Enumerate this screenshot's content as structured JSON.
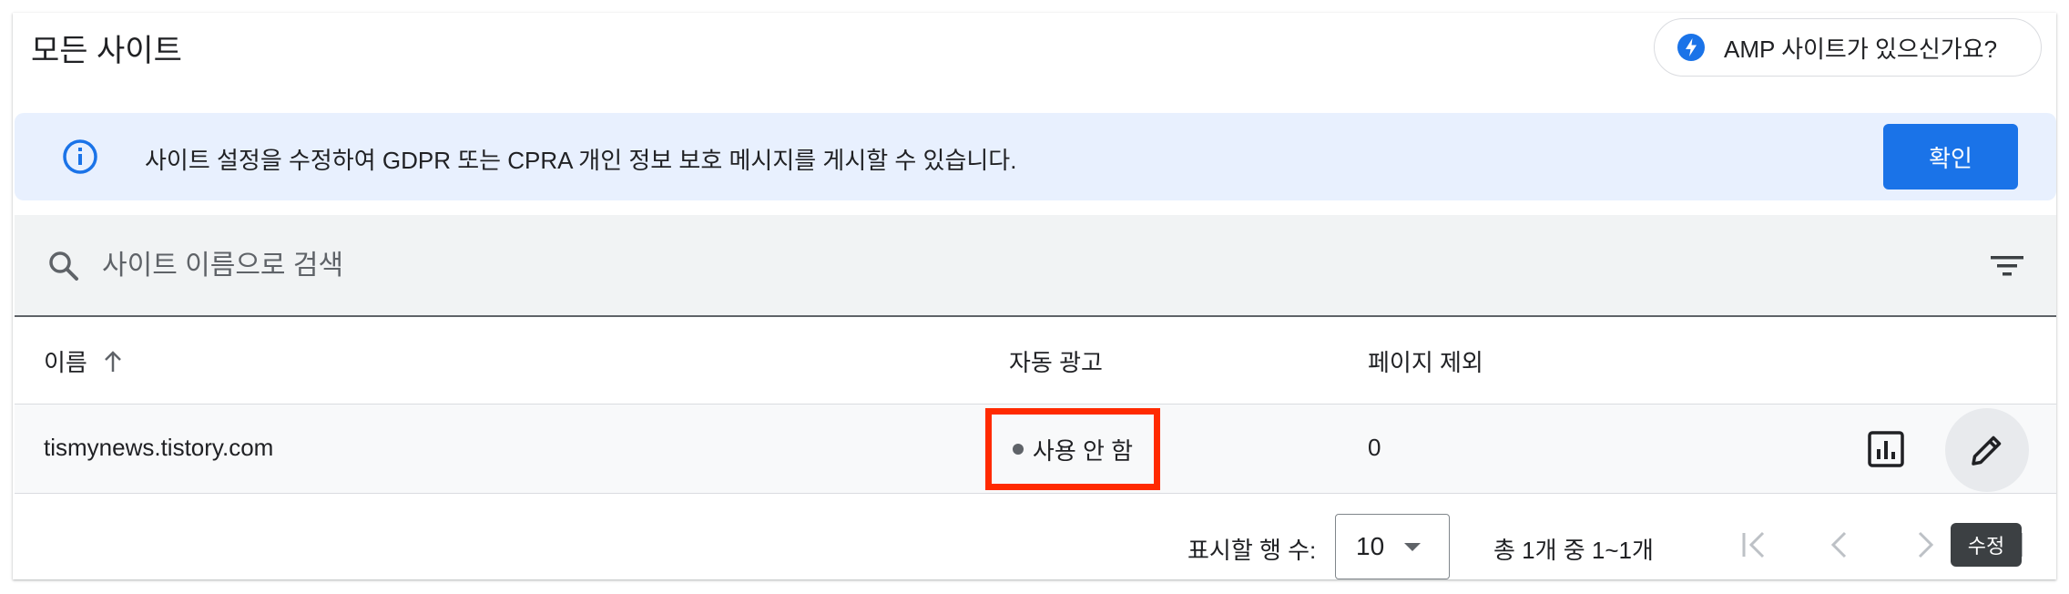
{
  "header": {
    "title": "모든 사이트",
    "amp_chip_label": "AMP 사이트가 있으신가요?",
    "amp_icon": "lightning-bolt-icon"
  },
  "banner": {
    "icon": "info-icon",
    "text": "사이트 설정을 수정하여 GDPR 또는 CPRA 개인 정보 보호 메시지를 게시할 수 있습니다.",
    "confirm_label": "확인"
  },
  "search": {
    "placeholder": "사이트 이름으로 검색",
    "value": ""
  },
  "table": {
    "columns": [
      {
        "label": "이름",
        "sort": "ascending"
      },
      {
        "label": "자동 광고"
      },
      {
        "label": "페이지 제외"
      }
    ],
    "rows": [
      {
        "name": "tismynews.tistory.com",
        "auto_ads": "사용 안 함",
        "page_exclusions": "0"
      }
    ]
  },
  "pagination": {
    "rows_per_page_label": "표시할 행 수:",
    "rows_per_page_value": "10",
    "range_text": "총 1개 중 1~1개"
  },
  "tooltip": {
    "text": "수정"
  },
  "colors": {
    "accent": "#1a73e8",
    "banner_bg": "#e8f0fe",
    "highlight_border": "#ff2a00"
  }
}
